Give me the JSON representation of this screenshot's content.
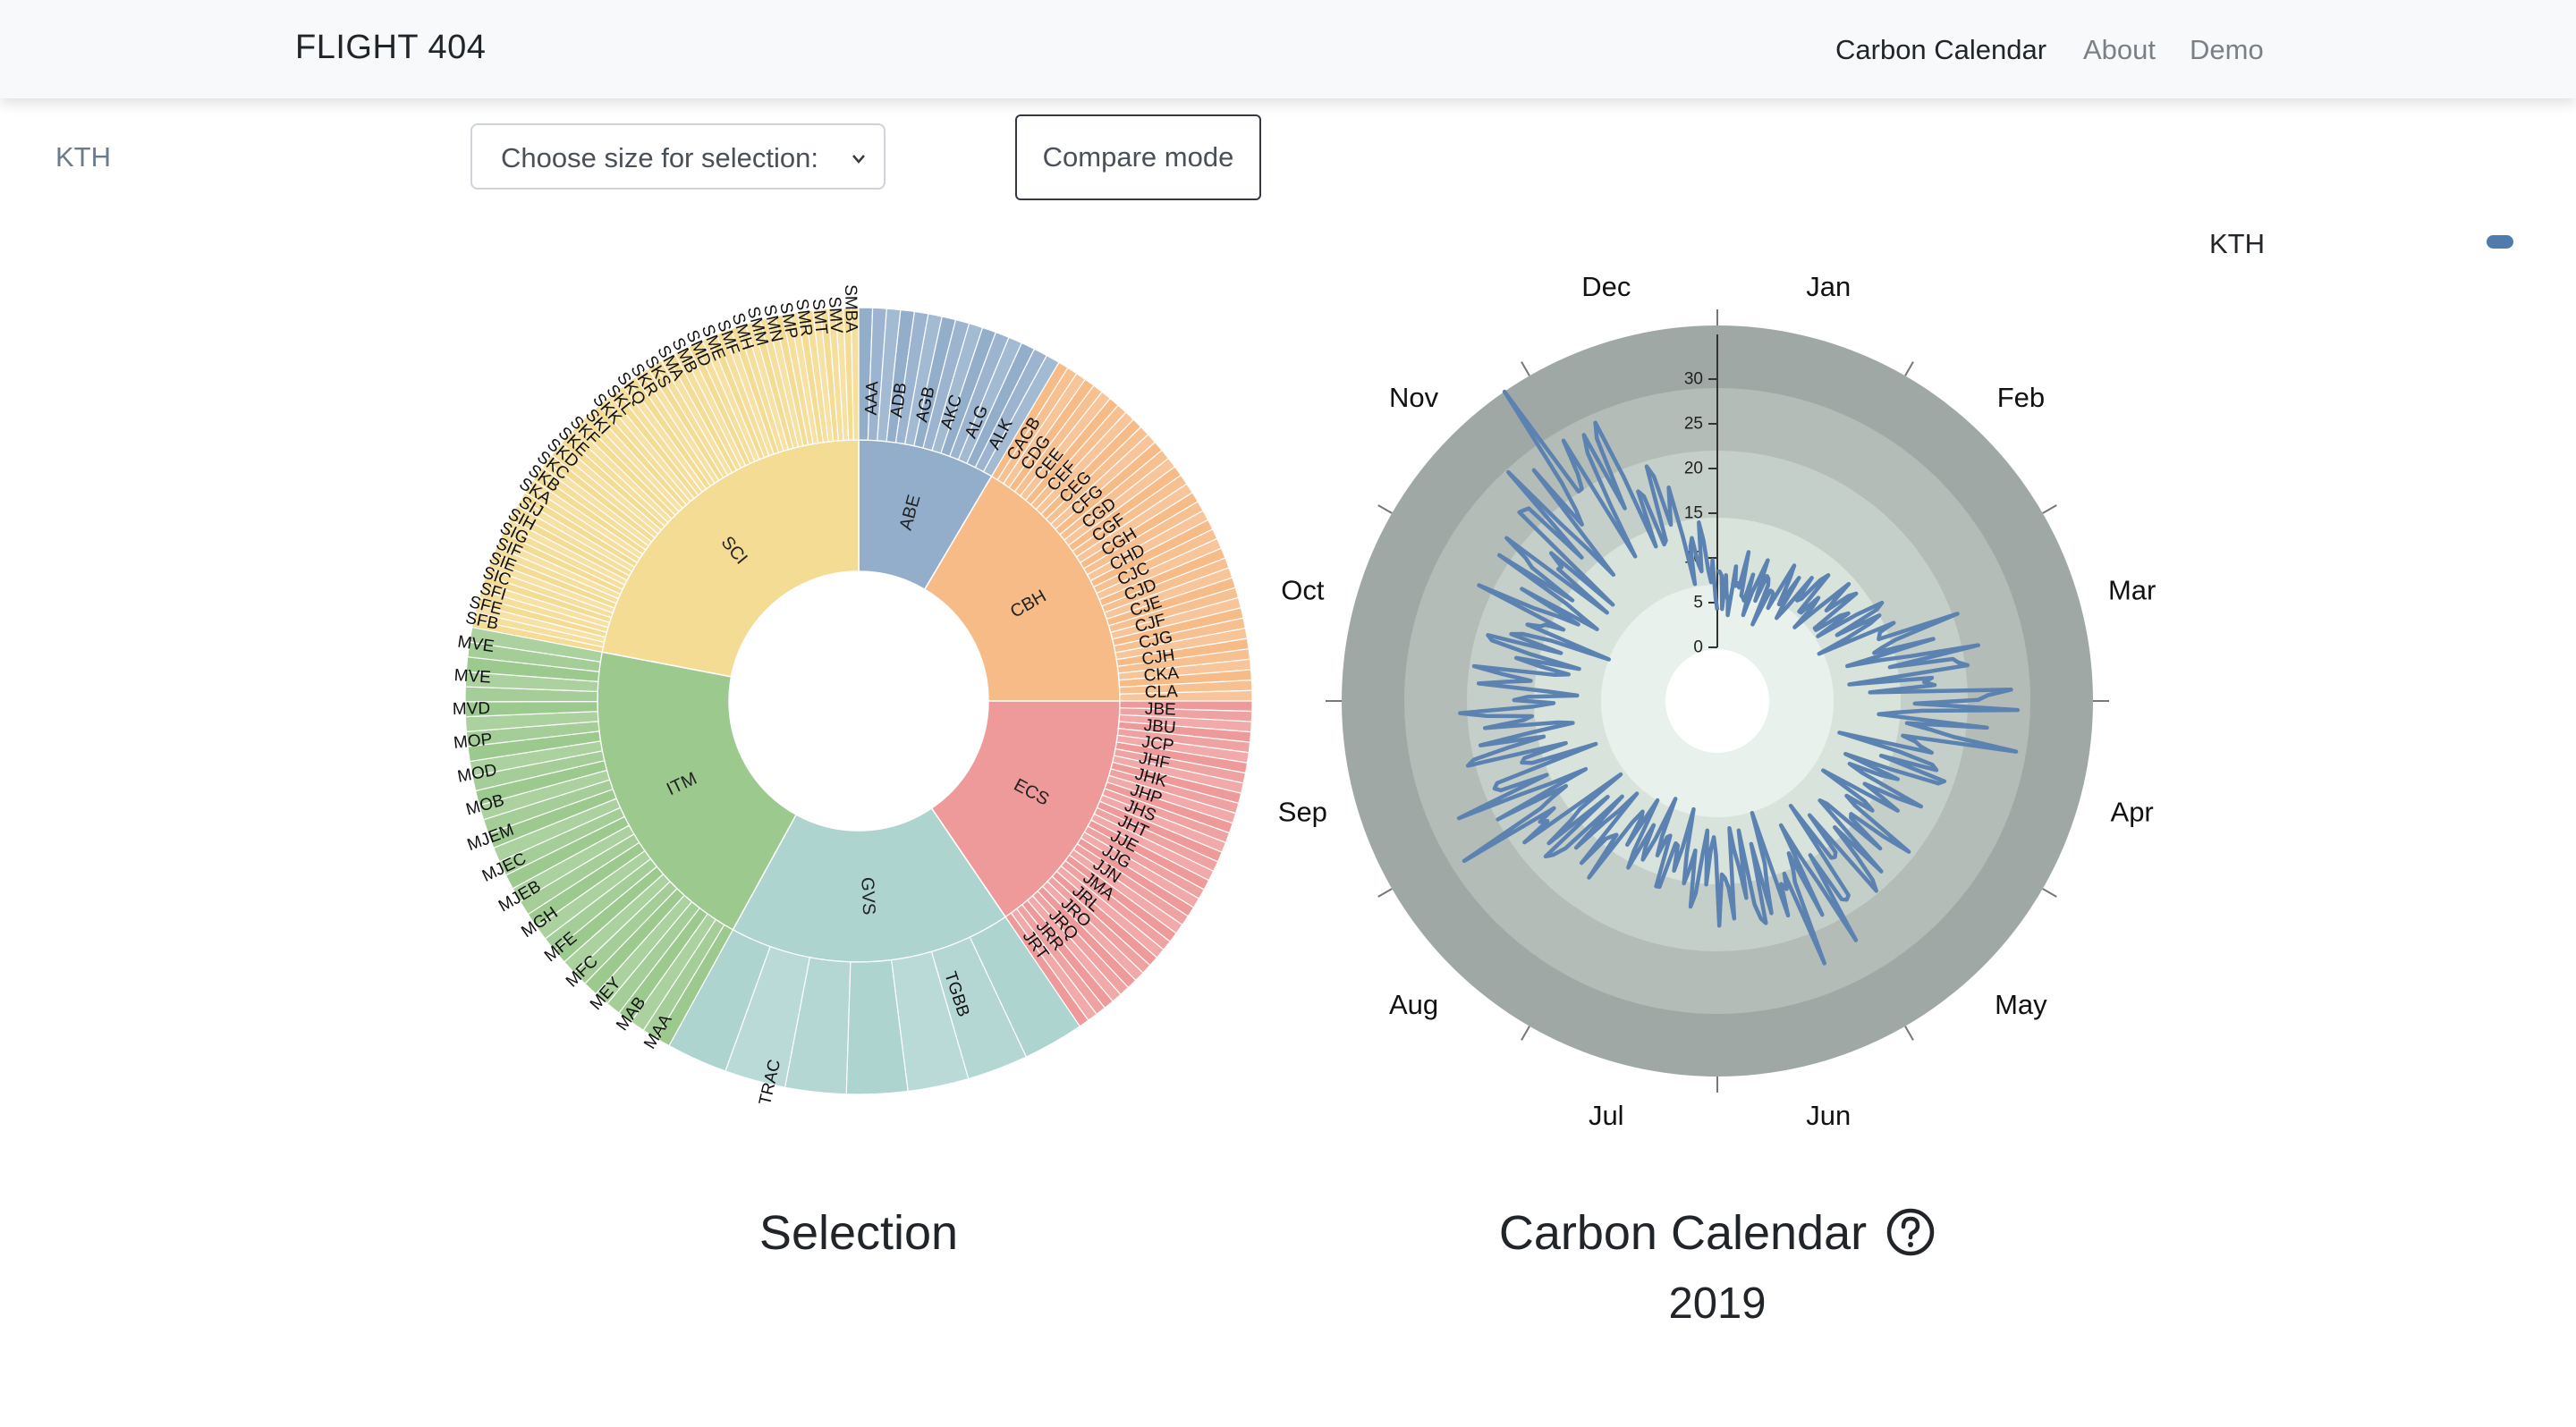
{
  "navbar": {
    "brand": "FLIGHT 404",
    "links": [
      {
        "label": "Carbon Calendar",
        "active": true
      },
      {
        "label": "About",
        "active": false
      },
      {
        "label": "Demo",
        "active": false
      }
    ]
  },
  "toolbar": {
    "org_label": "KTH",
    "size_select_value": "Choose size for selection:",
    "compare_button": "Compare mode"
  },
  "legend": {
    "label": "KTH",
    "color": "#4f7cac"
  },
  "selection": {
    "title": "Selection",
    "sectors": [
      {
        "code": "ABE",
        "color": "#93aecb",
        "share": 0.085,
        "labels": [
          "AAA",
          "ADB",
          "AGB",
          "AKC",
          "ALG",
          "ALK"
        ]
      },
      {
        "code": "CBH",
        "color": "#f6bb87",
        "share": 0.165,
        "labels": [
          "CACB",
          "CDG",
          "CEE",
          "CEF",
          "CEG",
          "CFG",
          "CGD",
          "CGF",
          "CGH",
          "CHD",
          "CJC",
          "CJD",
          "CJE",
          "CJF",
          "CJG",
          "CJH",
          "CKA",
          "CLA"
        ]
      },
      {
        "code": "ECS",
        "color": "#ee9a9a",
        "share": 0.155,
        "labels": [
          "JBE",
          "JBU",
          "JCP",
          "JHF",
          "JHK",
          "JHP",
          "JHS",
          "JHT",
          "JJE",
          "JJG",
          "JJN",
          "JMA",
          "JRL",
          "JRO",
          "JRQ",
          "JRR",
          "JRT"
        ]
      },
      {
        "code": "GVS",
        "color": "#aed4d0",
        "share": 0.175,
        "labels": [
          "TGBB",
          "TRAC"
        ]
      },
      {
        "code": "ITM",
        "color": "#9cc98e",
        "share": 0.2,
        "labels": [
          "MAA",
          "MAB",
          "MEY",
          "MFC",
          "MFE",
          "MGH",
          "MJEB",
          "MJEC",
          "MJEM",
          "MOB",
          "MOD",
          "MOP",
          "MVD",
          "MVE",
          "MVE"
        ]
      },
      {
        "code": "SCI",
        "color": "#f5dc95",
        "share": 0.22,
        "labels": [
          "SFB",
          "SFE",
          "SFI",
          "SIC",
          "SIE",
          "SIF",
          "SIG",
          "SIH",
          "SIJ",
          "SKA",
          "SKB",
          "SKC",
          "SKD",
          "SKE",
          "SKF",
          "SKI",
          "SKK",
          "SKL",
          "SKQ",
          "SKR",
          "SKS",
          "SMA",
          "SMB",
          "SMD",
          "SME",
          "SMF",
          "SMH",
          "SMM",
          "SMN",
          "SMP",
          "SMR",
          "SMT",
          "SMV",
          "SMBA"
        ]
      }
    ]
  },
  "calendar": {
    "title": "Carbon Calendar",
    "help_icon": "question-circle-icon",
    "year": "2019",
    "months": [
      "Jan",
      "Feb",
      "Mar",
      "Apr",
      "May",
      "Jun",
      "Jul",
      "Aug",
      "Sep",
      "Oct",
      "Nov",
      "Dec"
    ],
    "ticks": [
      0,
      5,
      10,
      15,
      20,
      25,
      30
    ],
    "ring_colors": [
      "#a0a8a5",
      "#b4bcb7",
      "#c5cfc9",
      "#d8e3dc",
      "#e9f1ec"
    ],
    "line_color": "#5b82b0"
  },
  "chart_data": {
    "type": "line",
    "title": "Carbon Calendar",
    "subtitle": "2019",
    "series": [
      {
        "name": "KTH",
        "x": [
          "Jan",
          "Feb",
          "Mar",
          "Apr",
          "May",
          "Jun",
          "Jul",
          "Aug",
          "Sep",
          "Oct",
          "Nov",
          "Dec"
        ],
        "values": [
          9,
          11,
          16,
          28,
          19,
          24,
          18,
          15,
          25,
          22,
          21,
          34
        ]
      }
    ],
    "ylim": [
      0,
      35
    ],
    "grid": true
  }
}
